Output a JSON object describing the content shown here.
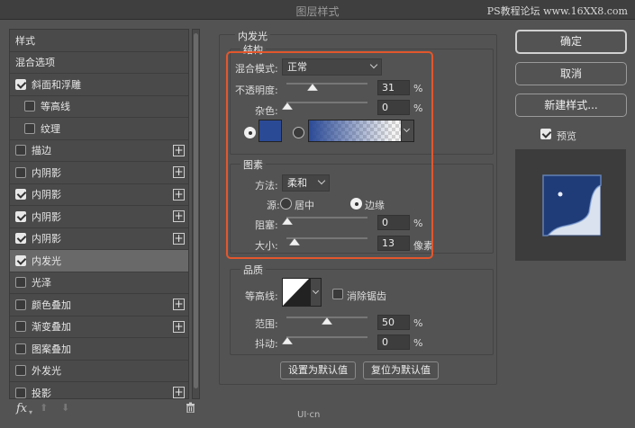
{
  "window": {
    "title": "图层样式",
    "watermark": "PS教程论坛 www.16XX8.com"
  },
  "style_list": {
    "items": [
      {
        "label": "样式",
        "checkbox": null,
        "checked": false,
        "plus": false,
        "selected": false,
        "indent": false
      },
      {
        "label": "混合选项",
        "checkbox": null,
        "checked": false,
        "plus": false,
        "selected": false,
        "indent": false
      },
      {
        "label": "斜面和浮雕",
        "checkbox": true,
        "checked": true,
        "plus": false,
        "selected": false,
        "indent": false
      },
      {
        "label": "等高线",
        "checkbox": true,
        "checked": false,
        "plus": false,
        "selected": false,
        "indent": true
      },
      {
        "label": "纹理",
        "checkbox": true,
        "checked": false,
        "plus": false,
        "selected": false,
        "indent": true
      },
      {
        "label": "描边",
        "checkbox": true,
        "checked": false,
        "plus": true,
        "selected": false,
        "indent": false
      },
      {
        "label": "内阴影",
        "checkbox": true,
        "checked": false,
        "plus": true,
        "selected": false,
        "indent": false
      },
      {
        "label": "内阴影",
        "checkbox": true,
        "checked": true,
        "plus": true,
        "selected": false,
        "indent": false
      },
      {
        "label": "内阴影",
        "checkbox": true,
        "checked": true,
        "plus": true,
        "selected": false,
        "indent": false
      },
      {
        "label": "内阴影",
        "checkbox": true,
        "checked": true,
        "plus": true,
        "selected": false,
        "indent": false
      },
      {
        "label": "内发光",
        "checkbox": true,
        "checked": true,
        "plus": false,
        "selected": true,
        "indent": false
      },
      {
        "label": "光泽",
        "checkbox": true,
        "checked": false,
        "plus": false,
        "selected": false,
        "indent": false
      },
      {
        "label": "颜色叠加",
        "checkbox": true,
        "checked": false,
        "plus": true,
        "selected": false,
        "indent": false
      },
      {
        "label": "渐变叠加",
        "checkbox": true,
        "checked": false,
        "plus": true,
        "selected": false,
        "indent": false
      },
      {
        "label": "图案叠加",
        "checkbox": true,
        "checked": false,
        "plus": false,
        "selected": false,
        "indent": false
      },
      {
        "label": "外发光",
        "checkbox": true,
        "checked": false,
        "plus": false,
        "selected": false,
        "indent": false
      },
      {
        "label": "投影",
        "checkbox": true,
        "checked": false,
        "plus": true,
        "selected": false,
        "indent": false
      }
    ],
    "footer": {
      "fx": "fx",
      "up": "⬆",
      "down": "⬇",
      "trash": "🗑"
    }
  },
  "panel": {
    "title": "内发光",
    "structure": {
      "title": "结构",
      "blend_mode_label": "混合模式:",
      "blend_mode_value": "正常",
      "opacity_label": "不透明度:",
      "opacity_value": "31",
      "noise_label": "杂色:",
      "noise_value": "0",
      "unit_percent": "%",
      "glow_color": "#2b4a96"
    },
    "elements": {
      "title": "图素",
      "method_label": "方法:",
      "method_value": "柔和",
      "source_label": "源:",
      "source_center": "居中",
      "source_edge": "边缘",
      "choke_label": "阻塞:",
      "choke_value": "0",
      "size_label": "大小:",
      "size_value": "13",
      "size_unit": "像素"
    },
    "quality": {
      "title": "品质",
      "contour_label": "等高线:",
      "antialias_label": "消除锯齿",
      "range_label": "范围:",
      "range_value": "50",
      "jitter_label": "抖动:",
      "jitter_value": "0"
    },
    "set_default": "设置为默认值",
    "reset_default": "复位为默认值"
  },
  "right": {
    "ok": "确定",
    "cancel": "取消",
    "new_style": "新建样式...",
    "preview_label": "预览",
    "preview_checked": true
  },
  "bottom_watermark": "UI·cn",
  "colors": {
    "highlight": "#e2572d",
    "panel_bg": "#535353"
  }
}
